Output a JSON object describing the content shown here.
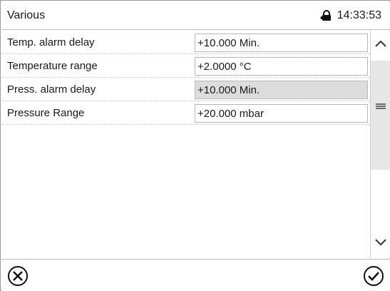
{
  "header": {
    "title": "Various",
    "time": "14:33:53",
    "status_icon": "lock-icon"
  },
  "settings": [
    {
      "label": "Temp. alarm delay",
      "value": "+10.000 Min.",
      "disabled": false
    },
    {
      "label": "Temperature range",
      "value": "+2.0000 °C",
      "disabled": false
    },
    {
      "label": "Press. alarm delay",
      "value": "+10.000 Min.",
      "disabled": true
    },
    {
      "label": "Pressure Range",
      "value": "+20.000 mbar",
      "disabled": false
    }
  ],
  "scrollbar": {
    "up_icon": "chevron-up-icon",
    "grip_icon": "grip-icon",
    "down_icon": "chevron-down-icon"
  },
  "footer": {
    "cancel_icon": "close-circle-icon",
    "confirm_icon": "check-circle-icon"
  }
}
